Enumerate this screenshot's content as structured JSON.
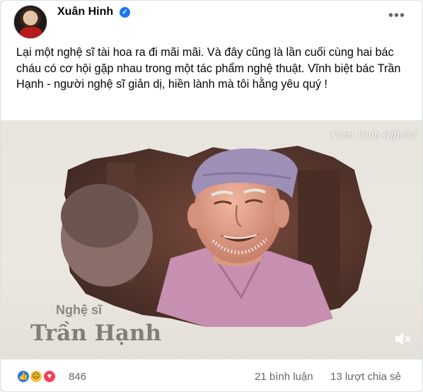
{
  "post": {
    "author": "Xuân Hinh",
    "verified": true,
    "text": "Lại một nghệ sĩ tài hoa ra đi mãi mãi. Và đây cũng là lần cuối cùng hai bác cháu có cơ hội gặp nhau trong một tác phẩm nghệ thuật. Vĩnh biệt bác Trần Hạnh - người nghệ sĩ giản dị, hiền lành mà tôi hằng yêu quý !"
  },
  "media": {
    "watermark": "Xuân Hinh Official",
    "caption_label": "Nghệ sĩ",
    "caption_name": "Trần Hạnh"
  },
  "footer": {
    "reactions_count": "846",
    "comments": "21 bình luận",
    "shares": "13 lượt chia sẻ"
  },
  "icons": {
    "verified": "verified-badge-icon",
    "more": "more-options-icon",
    "mute": "speaker-muted-icon",
    "reactions": [
      "like-icon",
      "sad-icon",
      "love-icon"
    ]
  },
  "colors": {
    "accent": "#1877f2",
    "secondary_text": "#65676b",
    "love": "#f33e58",
    "sad": "#f7c33c"
  }
}
